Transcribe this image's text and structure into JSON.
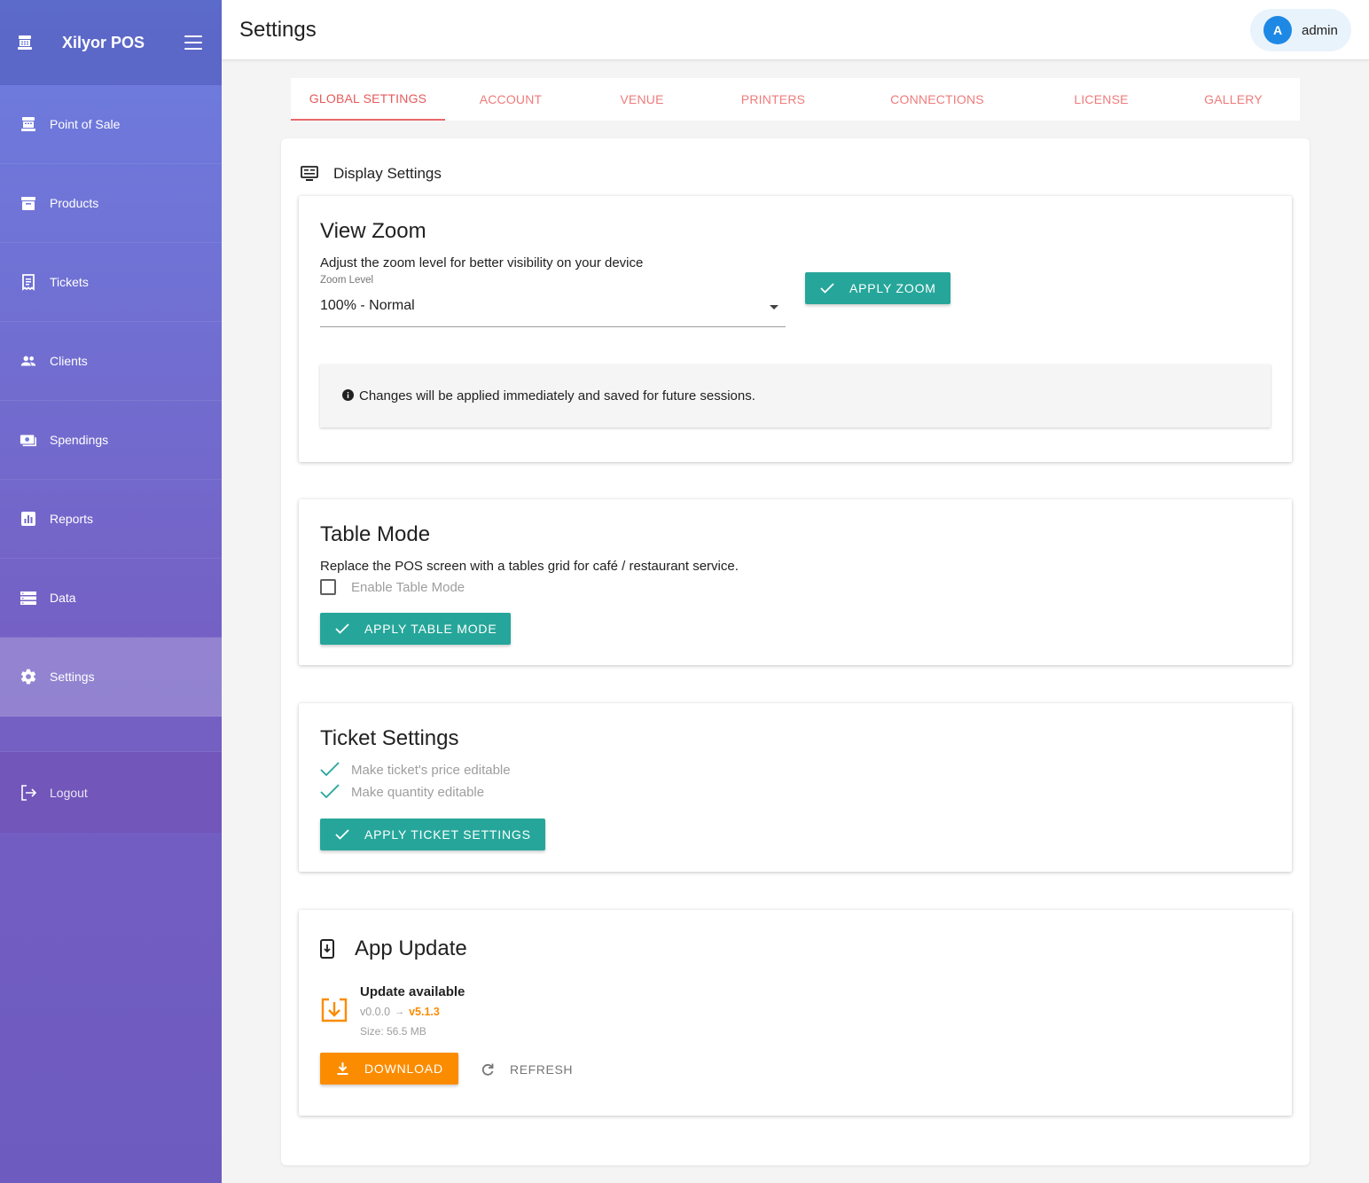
{
  "app": {
    "brand": "Xilyor POS",
    "page_title": "Settings"
  },
  "user": {
    "initial": "A",
    "name": "admin"
  },
  "sidebar": {
    "items": [
      {
        "label": "Point of Sale",
        "icon": "cash-register-icon"
      },
      {
        "label": "Products",
        "icon": "archive-box-icon"
      },
      {
        "label": "Tickets",
        "icon": "receipt-icon"
      },
      {
        "label": "Clients",
        "icon": "people-icon"
      },
      {
        "label": "Spendings",
        "icon": "money-icon"
      },
      {
        "label": "Reports",
        "icon": "bar-chart-icon"
      },
      {
        "label": "Data",
        "icon": "storage-icon"
      },
      {
        "label": "Settings",
        "icon": "gear-icon",
        "active": true
      }
    ],
    "logout_label": "Logout"
  },
  "tabs": [
    "Global Settings",
    "Account",
    "Venue",
    "Printers",
    "Connections",
    "License",
    "Gallery"
  ],
  "active_tab": "Global Settings",
  "display_settings": {
    "section_title": "Display Settings",
    "view_zoom": {
      "title": "View Zoom",
      "description": "Adjust the zoom level for better visibility on your device",
      "field_label": "Zoom Level",
      "value": "100% - Normal",
      "apply_label": "APPLY ZOOM",
      "info": "Changes will be applied immediately and saved for future sessions."
    },
    "table_mode": {
      "title": "Table Mode",
      "description": "Replace the POS screen with a tables grid for café / restaurant service.",
      "checkbox_label": "Enable Table Mode",
      "checked": false,
      "apply_label": "APPLY TABLE MODE"
    },
    "ticket_settings": {
      "title": "Ticket Settings",
      "options": [
        {
          "label": "Make ticket's price editable",
          "checked": true
        },
        {
          "label": "Make quantity editable",
          "checked": true
        }
      ],
      "apply_label": "APPLY TICKET SETTINGS"
    },
    "app_update": {
      "title": "App Update",
      "status": "Update available",
      "current_version": "v0.0.0",
      "arrow": "→",
      "new_version": "v5.1.3",
      "size": "Size: 56.5 MB",
      "download_label": "DOWNLOAD",
      "refresh_label": "REFRESH"
    }
  },
  "colors": {
    "teal": "#26a69a",
    "orange": "#fb8c00",
    "tab_red": "#ef7b7b",
    "avatar_blue": "#1e88e5"
  }
}
